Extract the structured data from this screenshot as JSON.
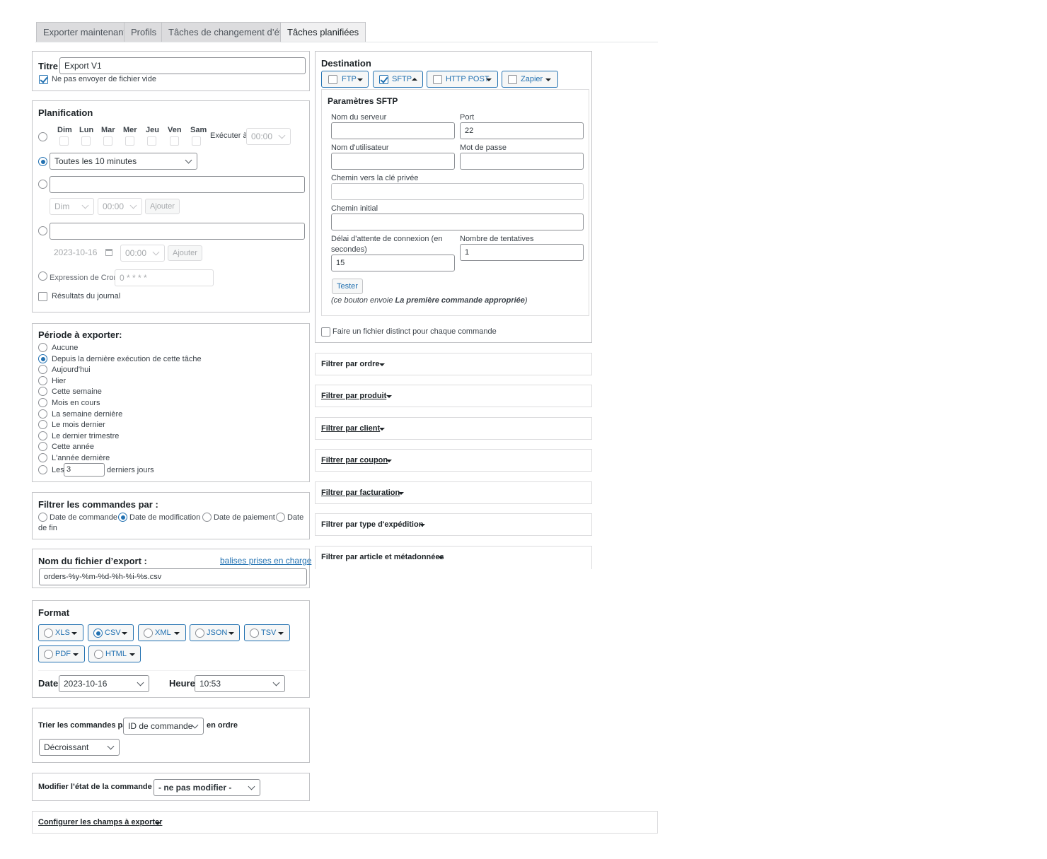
{
  "tabs": [
    "Exporter maintenant",
    "Profils",
    "Tâches de changement d’état",
    "Tâches planifiées"
  ],
  "title_box": {
    "label": "Titre",
    "value": "Export V1",
    "no_empty_label": "Ne pas envoyer de fichier vide",
    "no_empty_checked": true
  },
  "schedule": {
    "heading": "Planification",
    "days": [
      "Dim",
      "Lun",
      "Mar",
      "Mer",
      "Jeu",
      "Ven",
      "Sam"
    ],
    "run_at_label": "Exécuter à:",
    "run_at_value": "00:00",
    "interval_value": "Toutes les 10 minutes",
    "weekly_day": "Dim",
    "weekly_time": "00:00",
    "add_label": "Ajouter",
    "date_value": "2023-10-16",
    "date_time": "00:00",
    "cron_label": "Expression de Cron:",
    "cron_placeholder": "0 * * * *",
    "log_label": "Résultats du journal"
  },
  "period": {
    "heading": "Période à exporter:",
    "options": [
      "Aucune",
      "Depuis la dernière exécution de cette tâche",
      "Aujourd'hui",
      "Hier",
      "Cette semaine",
      "Mois en cours",
      "La semaine dernière",
      "Le mois dernier",
      "Le dernier trimestre",
      "Cette année",
      "L'année dernière"
    ],
    "selected": 1,
    "last_prefix": "Les",
    "last_value": "3",
    "last_suffix": "derniers jours"
  },
  "filter_orders": {
    "heading": "Filtrer les commandes par :",
    "options": [
      "Date de commande",
      "Date de modification",
      "Date de paiement",
      "Date"
    ],
    "wrap_text": "de fin",
    "selected": 1
  },
  "filename": {
    "label": "Nom du fichier d’export :",
    "link": "balises prises en charge",
    "value": "orders-%y-%m-%d-%h-%i-%s.csv"
  },
  "format": {
    "heading": "Format",
    "options": [
      "XLS",
      "CSV",
      "XML",
      "JSON",
      "TSV",
      "PDF",
      "HTML"
    ],
    "selected": "CSV",
    "date_label": "Date",
    "date_value": "2023-10-16",
    "time_label": "Heure",
    "time_value": "10:53"
  },
  "sort": {
    "label": "Trier les commandes par",
    "field": "ID de commande",
    "order_label": "en ordre",
    "order": "Décroissant"
  },
  "status": {
    "label": "Modifier l’état de la commande à",
    "value": "- ne pas modifier -"
  },
  "configure_fields": "Configurer les champs à exporter",
  "destination": {
    "heading": "Destination",
    "options": [
      {
        "label": "FTP",
        "checked": false
      },
      {
        "label": "SFTP",
        "checked": true
      },
      {
        "label": "HTTP POST",
        "checked": false
      },
      {
        "label": "Zapier",
        "checked": false
      }
    ],
    "sftp": {
      "heading": "Paramètres SFTP",
      "server_label": "Nom du serveur",
      "server_value": "",
      "port_label": "Port",
      "port_value": "22",
      "user_label": "Nom d'utilisateur",
      "user_value": "",
      "password_label": "Mot de passe",
      "password_value": "",
      "key_label": "Chemin vers la clé privée",
      "initial_path_label": "Chemin initial",
      "timeout_label_1": "Délai d'attente de connexion (en",
      "timeout_label_2": "secondes)",
      "timeout_value": "15",
      "retries_label": "Nombre de tentatives",
      "retries_value": "1",
      "test_button": "Tester",
      "note_prefix": "(ce bouton envoie ",
      "note_bold": "La première commande appropriée",
      "note_suffix": ")"
    },
    "separate_file_label": "Faire un fichier distinct pour chaque commande"
  },
  "filters": [
    "Filtrer par ordre",
    "Filtrer par produit",
    "Filtrer par client",
    "Filtrer par coupon",
    "Filtrer par facturation",
    "Filtrer par type d'expédition",
    "Filtrer par article et métadonnées"
  ]
}
